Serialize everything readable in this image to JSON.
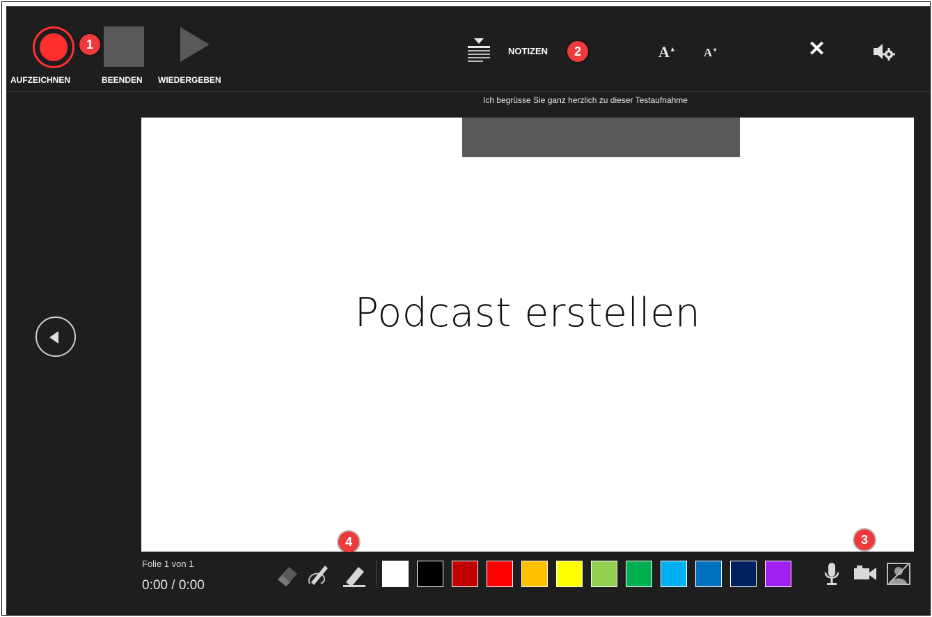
{
  "toolbar": {
    "record_label": "AUFZEICHNEN",
    "stop_label": "BEENDEN",
    "play_label": "WIEDERGEBEN",
    "notes_label": "NOTIZEN",
    "font_increase": "A",
    "font_decrease": "A",
    "close_glyph": "✕",
    "icons": [
      "record-icon",
      "stop-icon",
      "play-icon",
      "notes-icon",
      "font-increase-icon",
      "font-decrease-icon",
      "close-icon",
      "audio-settings-icon"
    ]
  },
  "badges": {
    "one": "1",
    "two": "2",
    "three": "3",
    "four": "4",
    "color": "#ed3a3a"
  },
  "notes": {
    "text": "Ich begrüsse Sie ganz herzlich zu dieser Testaufnahme"
  },
  "slide": {
    "title": "Podcast erstellen"
  },
  "status": {
    "slide_counter": "Folie 1 von 1",
    "time": "0:00 / 0:00"
  },
  "ink_tools": [
    "eraser-icon",
    "pen-icon",
    "highlighter-icon"
  ],
  "palette": [
    {
      "name": "white",
      "color": "#ffffff"
    },
    {
      "name": "black",
      "color": "#000000"
    },
    {
      "name": "dark-red",
      "color": "#c00000"
    },
    {
      "name": "red",
      "color": "#ff0000"
    },
    {
      "name": "orange",
      "color": "#ffc000"
    },
    {
      "name": "yellow",
      "color": "#ffff00"
    },
    {
      "name": "light-green",
      "color": "#92d050"
    },
    {
      "name": "green",
      "color": "#00b050"
    },
    {
      "name": "light-blue",
      "color": "#00b0f0"
    },
    {
      "name": "blue",
      "color": "#0070c0"
    },
    {
      "name": "dark-blue",
      "color": "#002060"
    },
    {
      "name": "purple",
      "color": "#a020f0"
    }
  ],
  "media": [
    "microphone-icon",
    "camera-icon",
    "camera-preview-off-icon"
  ]
}
